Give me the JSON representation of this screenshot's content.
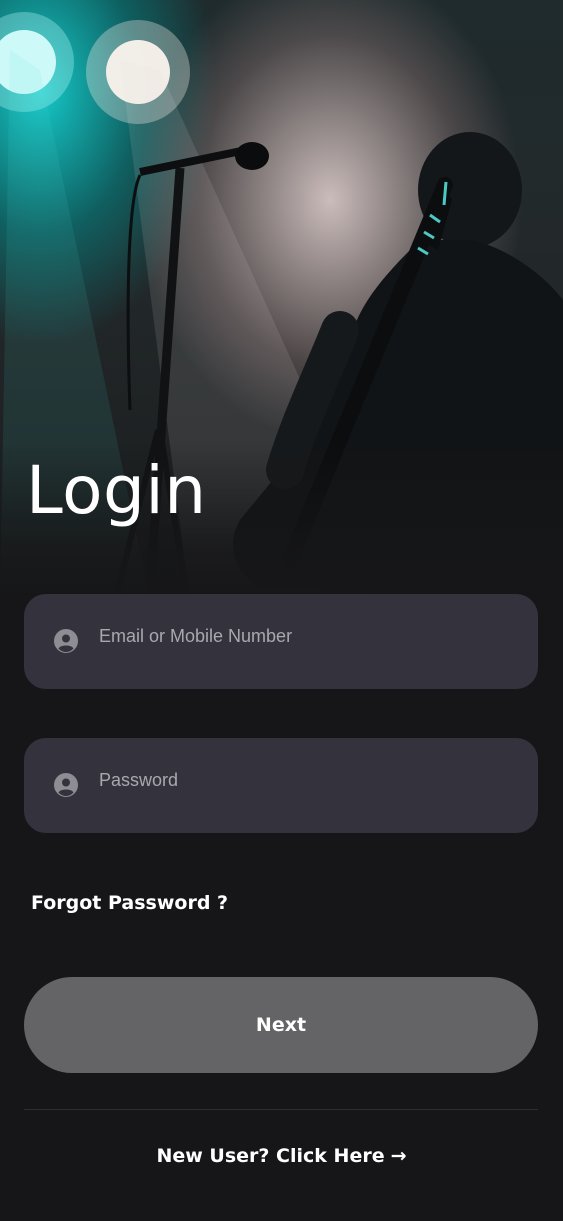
{
  "page": {
    "title": "Login",
    "background_image": "concert-guitarist-photo"
  },
  "form": {
    "email": {
      "placeholder": "Email or Mobile Number",
      "value": "",
      "icon": "user-icon"
    },
    "password": {
      "placeholder": "Password",
      "value": "",
      "icon": "user-icon"
    },
    "forgot_label": "Forgot Password ?",
    "next_label": "Next"
  },
  "footer": {
    "new_user_label": "New User? Click Here",
    "arrow_icon": "arrow-right-icon",
    "arrow_glyph": "→"
  },
  "colors": {
    "background": "#161618",
    "field_background": "#34323c",
    "button_background": "#646466",
    "text": "#ffffff",
    "placeholder": "#a9a8ae"
  }
}
